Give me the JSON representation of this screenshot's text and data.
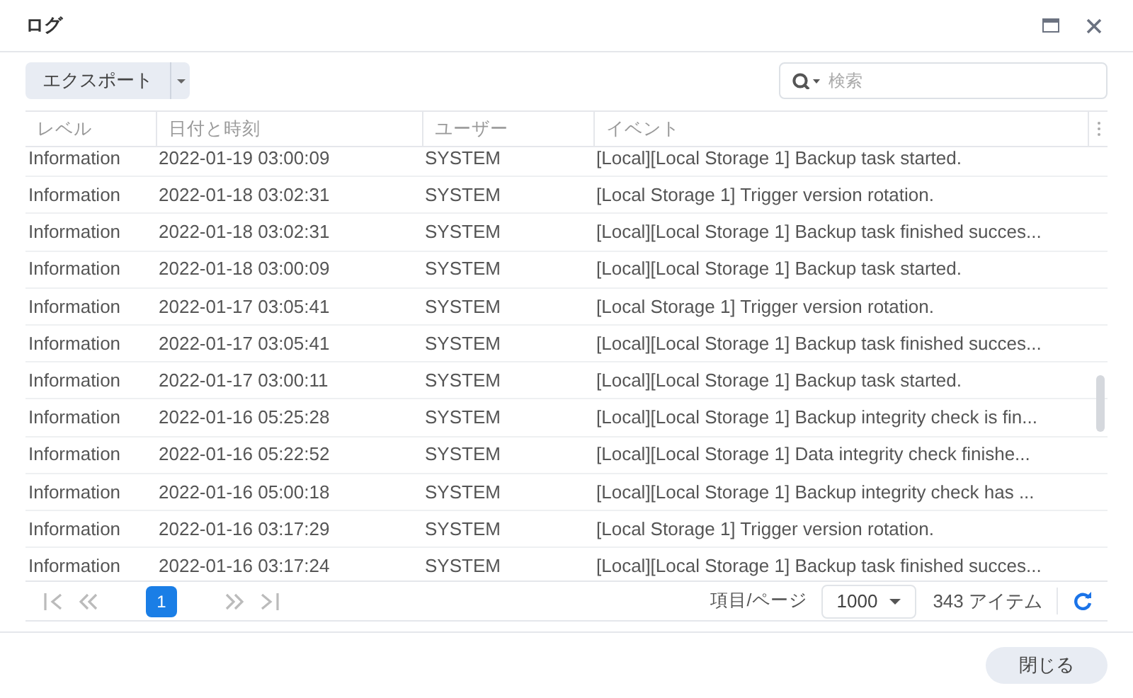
{
  "window": {
    "title": "ログ"
  },
  "toolbar": {
    "export_button": "エクスポート",
    "search": {
      "placeholder": "検索"
    }
  },
  "table": {
    "columns": [
      "レベル",
      "日付と時刻",
      "ユーザー",
      "イベント"
    ],
    "rows": [
      [
        "Information",
        "2022-01-19 03:00:09",
        "SYSTEM",
        "[Local][Local Storage 1] Backup task started."
      ],
      [
        "Information",
        "2022-01-18 03:02:31",
        "SYSTEM",
        "[Local Storage 1] Trigger version rotation."
      ],
      [
        "Information",
        "2022-01-18 03:02:31",
        "SYSTEM",
        "[Local][Local Storage 1] Backup task finished succes..."
      ],
      [
        "Information",
        "2022-01-18 03:00:09",
        "SYSTEM",
        "[Local][Local Storage 1] Backup task started."
      ],
      [
        "Information",
        "2022-01-17 03:05:41",
        "SYSTEM",
        "[Local Storage 1] Trigger version rotation."
      ],
      [
        "Information",
        "2022-01-17 03:05:41",
        "SYSTEM",
        "[Local][Local Storage 1] Backup task finished succes..."
      ],
      [
        "Information",
        "2022-01-17 03:00:11",
        "SYSTEM",
        "[Local][Local Storage 1] Backup task started."
      ],
      [
        "Information",
        "2022-01-16 05:25:28",
        "SYSTEM",
        "[Local][Local Storage 1] Backup integrity check is fin..."
      ],
      [
        "Information",
        "2022-01-16 05:22:52",
        "SYSTEM",
        "[Local][Local Storage 1] Data integrity check finishe..."
      ],
      [
        "Information",
        "2022-01-16 05:00:18",
        "SYSTEM",
        "[Local][Local Storage 1] Backup integrity check has ..."
      ],
      [
        "Information",
        "2022-01-16 03:17:29",
        "SYSTEM",
        "[Local Storage 1] Trigger version rotation."
      ],
      [
        "Information",
        "2022-01-16 03:17:24",
        "SYSTEM",
        "[Local][Local Storage 1] Backup task finished succes..."
      ]
    ]
  },
  "pagination": {
    "pages": [
      {
        "label": "1",
        "selected": true
      }
    ],
    "per_page_label": "項目/ページ",
    "per_page": "1000",
    "total": "343 アイテム"
  },
  "footer": {
    "close_button": "閉じる"
  }
}
